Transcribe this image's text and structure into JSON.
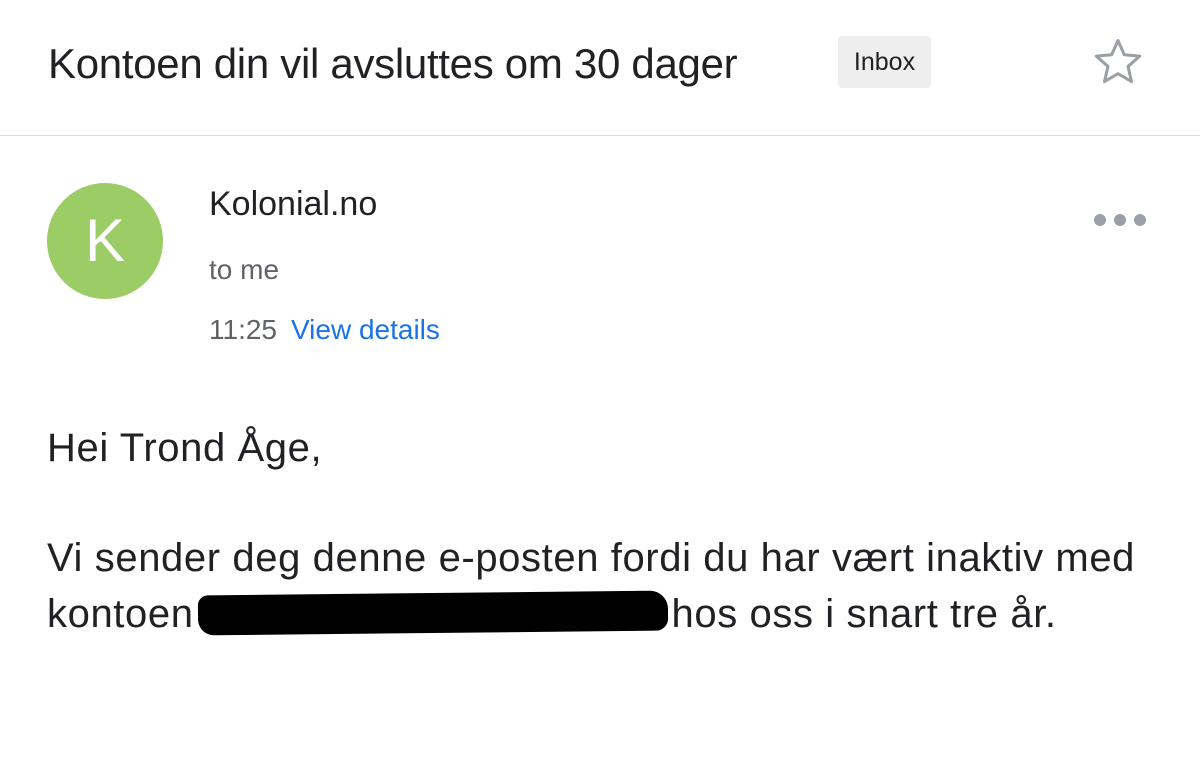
{
  "header": {
    "subject": "Kontoen din vil avsluttes om 30 dager",
    "label": "Inbox",
    "star_icon": "star-outline-icon"
  },
  "message": {
    "avatar_letter": "K",
    "avatar_color": "#9ccc65",
    "sender": "Kolonial.no",
    "recipient": "to me",
    "time": "11:25",
    "details_link": "View details",
    "more_icon": "more-horizontal-icon"
  },
  "body": {
    "greeting": "Hei Trond Åge,",
    "para_before": "Vi sender deg denne e-posten fordi du har vært inaktiv med kontoen",
    "para_after": "hos oss i snart tre år."
  },
  "colors": {
    "link": "#1a73e8",
    "secondary_text": "#5f6368",
    "badge_bg": "#eeeeee"
  }
}
